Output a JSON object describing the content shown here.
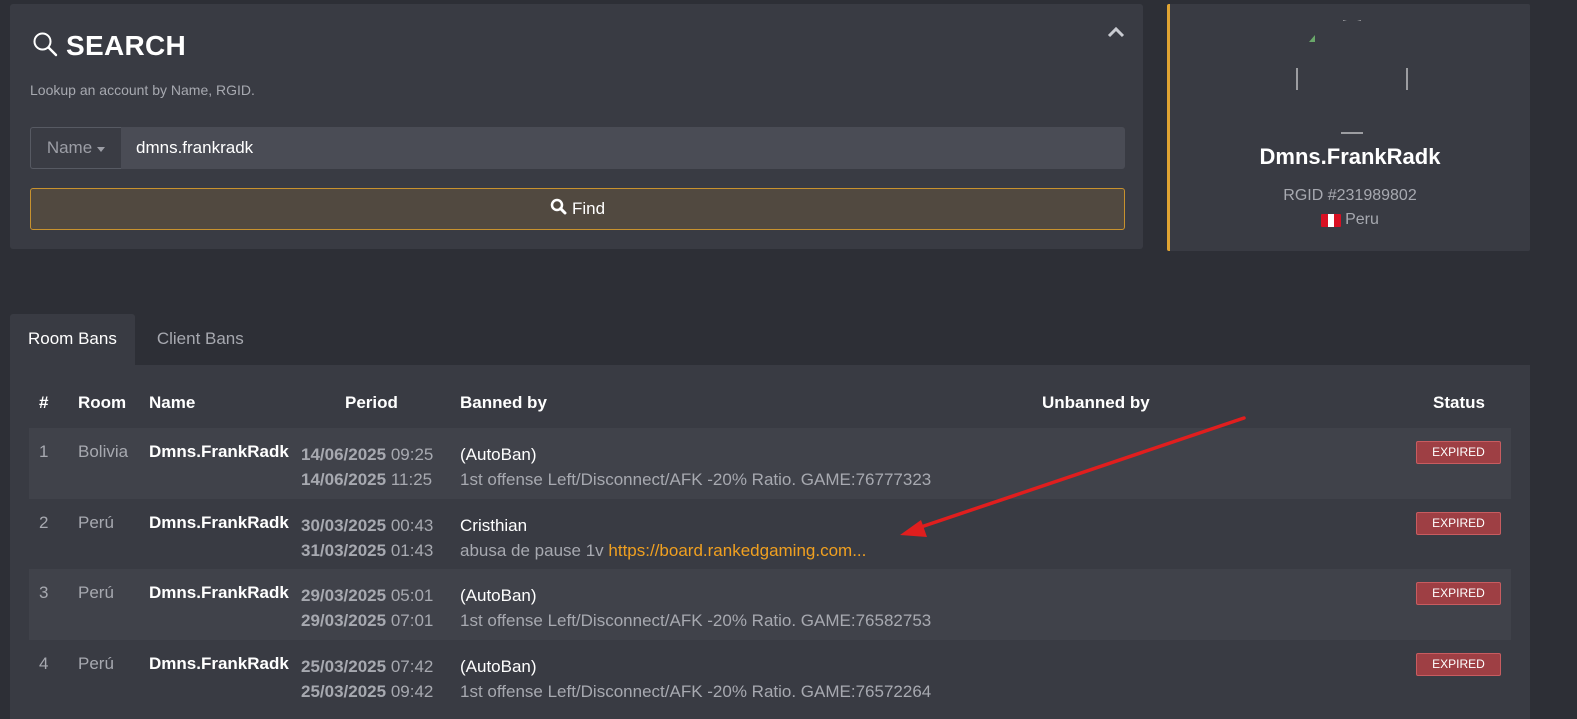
{
  "search": {
    "title": "SEARCH",
    "subtitle": "Lookup an account by Name, RGID.",
    "type_selected": "Name",
    "query": "dmns.frankradk",
    "find_label": "Find"
  },
  "profile": {
    "name": "Dmns.FrankRadk",
    "rgid": "RGID #231989802",
    "country": "Peru"
  },
  "tabs": [
    {
      "label": "Room Bans",
      "active": true
    },
    {
      "label": "Client Bans",
      "active": false
    }
  ],
  "table": {
    "headers": {
      "num": "#",
      "room": "Room",
      "name": "Name",
      "period": "Period",
      "banned_by": "Banned by",
      "unbanned_by": "Unbanned by",
      "status": "Status"
    },
    "rows": [
      {
        "num": "1",
        "room": "Bolivia",
        "name": "Dmns.FrankRadk",
        "start_date": "14/06/2025",
        "start_time": "09:25",
        "end_date": "14/06/2025",
        "end_time": "11:25",
        "banned_by": "(AutoBan)",
        "reason": "1st offense Left/Disconnect/AFK -20% Ratio. GAME:76777323",
        "link": "",
        "status": "EXPIRED"
      },
      {
        "num": "2",
        "room": "Perú",
        "name": "Dmns.FrankRadk",
        "start_date": "30/03/2025",
        "start_time": "00:43",
        "end_date": "31/03/2025",
        "end_time": "01:43",
        "banned_by": "Cristhian",
        "reason": "abusa de pause 1v",
        "link": "https://board.rankedgaming.com...",
        "status": "EXPIRED"
      },
      {
        "num": "3",
        "room": "Perú",
        "name": "Dmns.FrankRadk",
        "start_date": "29/03/2025",
        "start_time": "05:01",
        "end_date": "29/03/2025",
        "end_time": "07:01",
        "banned_by": "(AutoBan)",
        "reason": "1st offense Left/Disconnect/AFK -20% Ratio. GAME:76582753",
        "link": "",
        "status": "EXPIRED"
      },
      {
        "num": "4",
        "room": "Perú",
        "name": "Dmns.FrankRadk",
        "start_date": "25/03/2025",
        "start_time": "07:42",
        "end_date": "25/03/2025",
        "end_time": "09:42",
        "banned_by": "(AutoBan)",
        "reason": "1st offense Left/Disconnect/AFK -20% Ratio. GAME:76572264",
        "link": "",
        "status": "EXPIRED"
      }
    ]
  },
  "colors": {
    "accent": "#e0a433",
    "link": "#f0a020",
    "annotation_arrow": "#e01e1e",
    "status_expired": "#9e3f44"
  },
  "icons": [
    "search-icon",
    "chevron-up-icon",
    "caret-down-icon",
    "peru-flag-icon"
  ]
}
